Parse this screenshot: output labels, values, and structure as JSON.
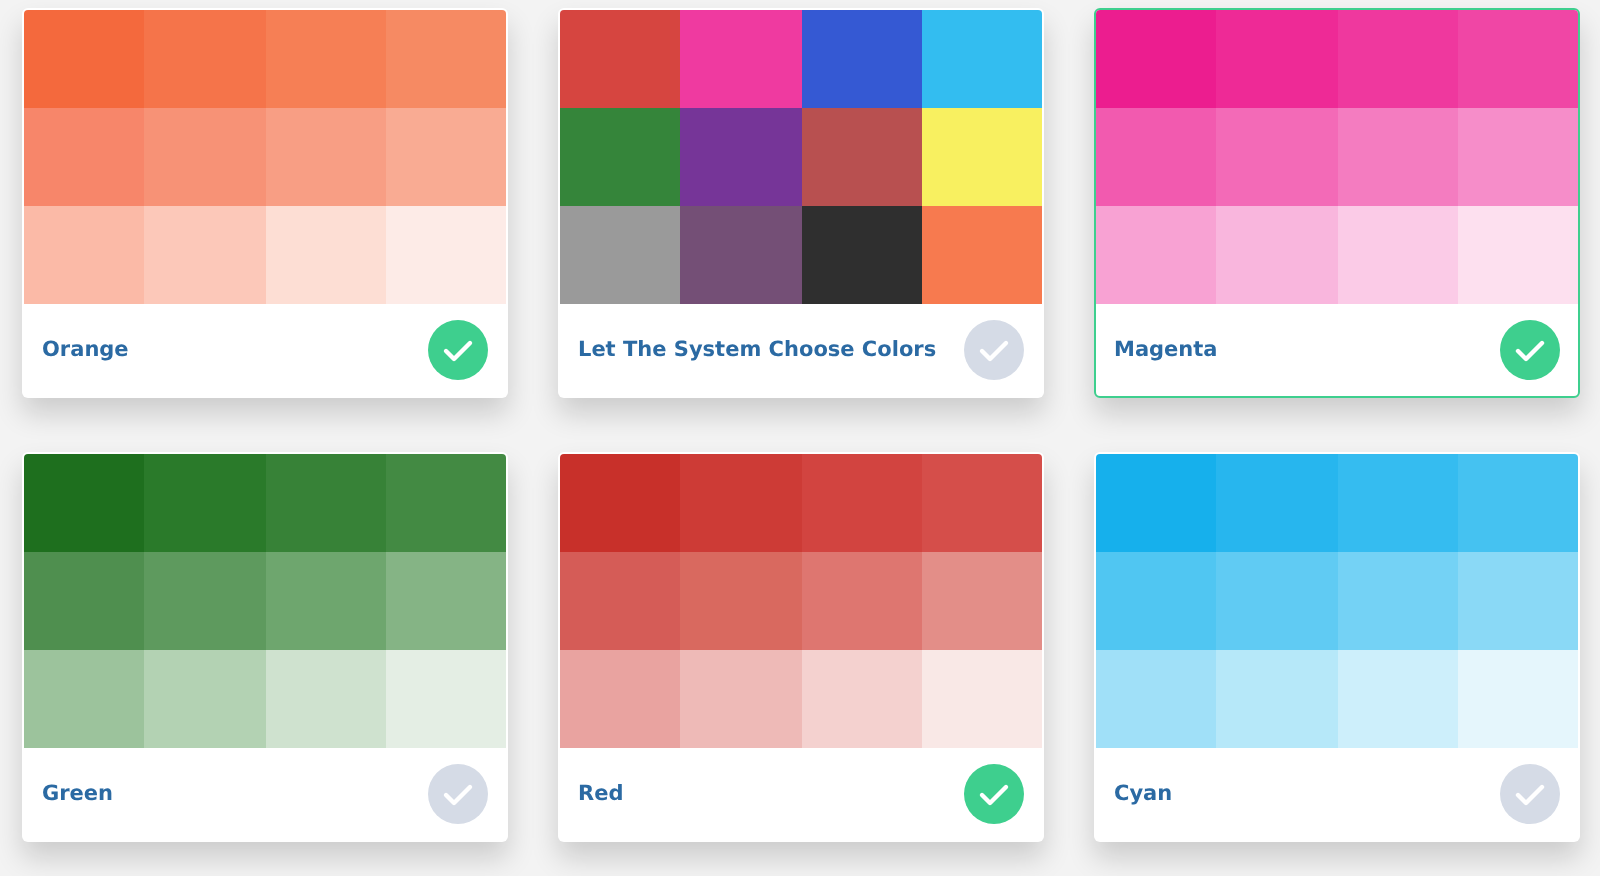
{
  "palettes": [
    {
      "name": "Orange",
      "checked": true,
      "selected": false,
      "swatches": [
        {
          "color": "#f4693d"
        },
        {
          "color": "#f5744a"
        },
        {
          "color": "#f67f55"
        },
        {
          "color": "#f68a63"
        },
        {
          "color": "#f7866a"
        },
        {
          "color": "#f79276"
        },
        {
          "color": "#f89e84"
        },
        {
          "color": "#f9ab93"
        },
        {
          "color": "#fbbaa7"
        },
        {
          "color": "#fcc8b9"
        },
        {
          "color": "#fdded4"
        },
        {
          "color": "#fdebe7"
        }
      ]
    },
    {
      "name": "Let The System Choose Colors",
      "checked": false,
      "selected": false,
      "swatches": [
        {
          "color": "#d64540"
        },
        {
          "color": "#ef3aa0"
        },
        {
          "color": "#3559d3"
        },
        {
          "color": "#33bdf0"
        },
        {
          "color": "#35853a"
        },
        {
          "color": "#763598"
        },
        {
          "color": "#b85050"
        },
        {
          "color": "#f8f060"
        },
        {
          "color": "#9a9a9a"
        },
        {
          "color": "#744f76"
        },
        {
          "color": "#2f2f2f"
        },
        {
          "color": "#f77a4f"
        }
      ]
    },
    {
      "name": "Magenta",
      "checked": true,
      "selected": true,
      "swatches": [
        {
          "color": "#ec1d8f"
        },
        {
          "color": "#ee2a96"
        },
        {
          "color": "#ef389e"
        },
        {
          "color": "#f046a5"
        },
        {
          "color": "#f25aaf"
        },
        {
          "color": "#f36ab7"
        },
        {
          "color": "#f47cc0"
        },
        {
          "color": "#f68dc9"
        },
        {
          "color": "#f8a2d3"
        },
        {
          "color": "#f9b6dd"
        },
        {
          "color": "#fbcbe7"
        },
        {
          "color": "#fde0ef"
        }
      ]
    },
    {
      "name": "Green",
      "checked": false,
      "selected": false,
      "swatches": [
        {
          "color": "#1e6f1e"
        },
        {
          "color": "#2a7a2a"
        },
        {
          "color": "#378237"
        },
        {
          "color": "#438a43"
        },
        {
          "color": "#4f8f4f"
        },
        {
          "color": "#5e9a5e"
        },
        {
          "color": "#6ea66e"
        },
        {
          "color": "#85b485"
        },
        {
          "color": "#9cc39c"
        },
        {
          "color": "#b3d2b3"
        },
        {
          "color": "#cfe2cf"
        },
        {
          "color": "#e4eee4"
        }
      ]
    },
    {
      "name": "Red",
      "checked": true,
      "selected": false,
      "swatches": [
        {
          "color": "#c8302a"
        },
        {
          "color": "#cd3b36"
        },
        {
          "color": "#d24440"
        },
        {
          "color": "#d54e4a"
        },
        {
          "color": "#d55c57"
        },
        {
          "color": "#d9695f"
        },
        {
          "color": "#de7670"
        },
        {
          "color": "#e38e88"
        },
        {
          "color": "#e9a3a0"
        },
        {
          "color": "#eebab7"
        },
        {
          "color": "#f4d1cf"
        },
        {
          "color": "#f9e8e6"
        }
      ]
    },
    {
      "name": "Cyan",
      "checked": false,
      "selected": false,
      "swatches": [
        {
          "color": "#16b0ec"
        },
        {
          "color": "#27b6ee"
        },
        {
          "color": "#35bcf0"
        },
        {
          "color": "#45c2f1"
        },
        {
          "color": "#50c6f2"
        },
        {
          "color": "#60cbf3"
        },
        {
          "color": "#74d2f5"
        },
        {
          "color": "#8ad9f6"
        },
        {
          "color": "#a0e0f8"
        },
        {
          "color": "#b6e8f9"
        },
        {
          "color": "#cdeffb"
        },
        {
          "color": "#e5f6fc"
        }
      ]
    }
  ]
}
